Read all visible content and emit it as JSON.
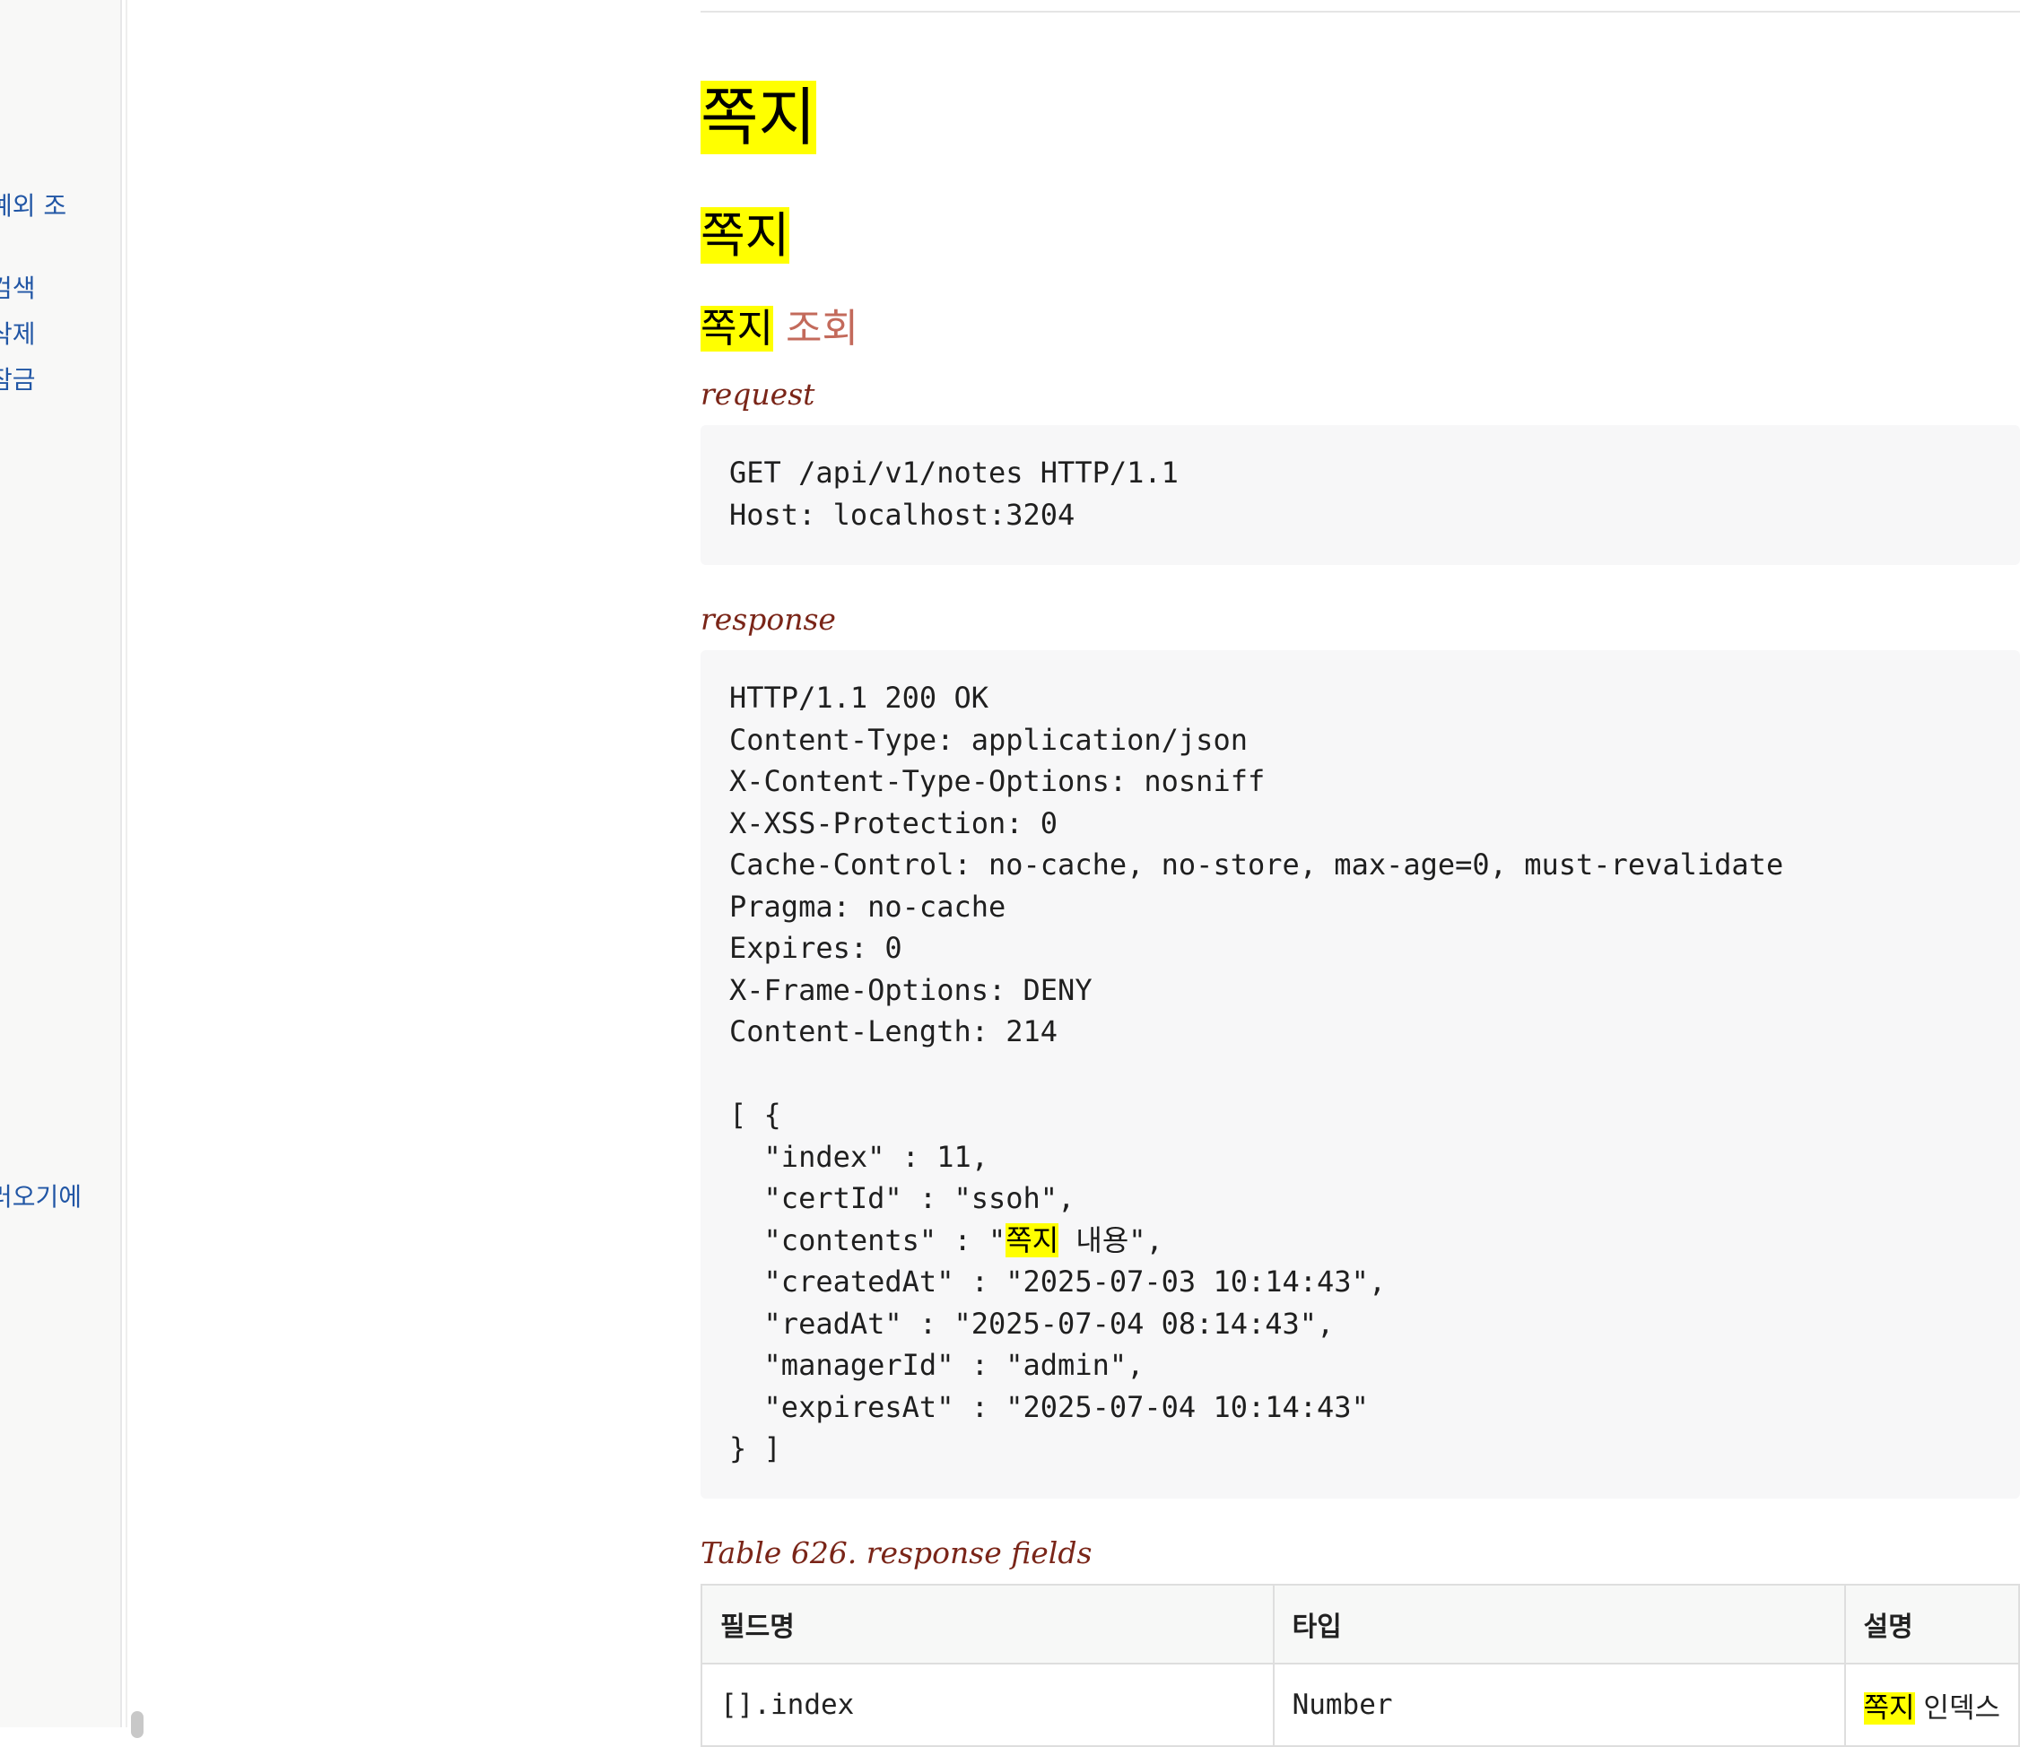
{
  "sidebar": {
    "items": [
      "예외 조",
      "검색",
      "삭제",
      "잠금",
      "러오기에"
    ]
  },
  "section": {
    "h2": "쪽지",
    "h3": "쪽지",
    "h4_highlight": "쪽지",
    "h4_rest": "조회"
  },
  "request": {
    "label": "request",
    "lines": [
      "GET /api/v1/notes HTTP/1.1",
      "Host: localhost:3204"
    ]
  },
  "response": {
    "label": "response",
    "headers": [
      "HTTP/1.1 200 OK",
      "Content-Type: application/json",
      "X-Content-Type-Options: nosniff",
      "X-XSS-Protection: 0",
      "Cache-Control: no-cache, no-store, max-age=0, must-revalidate",
      "Pragma: no-cache",
      "Expires: 0",
      "X-Frame-Options: DENY",
      "Content-Length: 214"
    ],
    "body_open": "[ {",
    "index_line": "  \"index\" : 11,",
    "certid_line": "  \"certId\" : \"ssoh\",",
    "contents_prefix": "  \"contents\" : \"",
    "contents_highlight": "쪽지",
    "contents_suffix": " 내용\",",
    "createdat_line": "  \"createdAt\" : \"2025-07-03 10:14:43\",",
    "readat_line": "  \"readAt\" : \"2025-07-04 08:14:43\",",
    "managerid_line": "  \"managerId\" : \"admin\",",
    "expiresat_line": "  \"expiresAt\" : \"2025-07-04 10:14:43\"",
    "body_close": "} ]"
  },
  "fields_table": {
    "caption": "Table 626. response fields",
    "headers": [
      "필드명",
      "타입",
      "설명"
    ],
    "rows": [
      {
        "field": "[].index",
        "type": "Number",
        "desc_highlight": "쪽지",
        "desc_rest": " 인덱스"
      }
    ]
  },
  "colors": {
    "highlight": "#ffff00",
    "heading": "#ba3925",
    "label": "#7a2518",
    "link": "#2156a5",
    "code_bg": "#f7f7f8"
  }
}
